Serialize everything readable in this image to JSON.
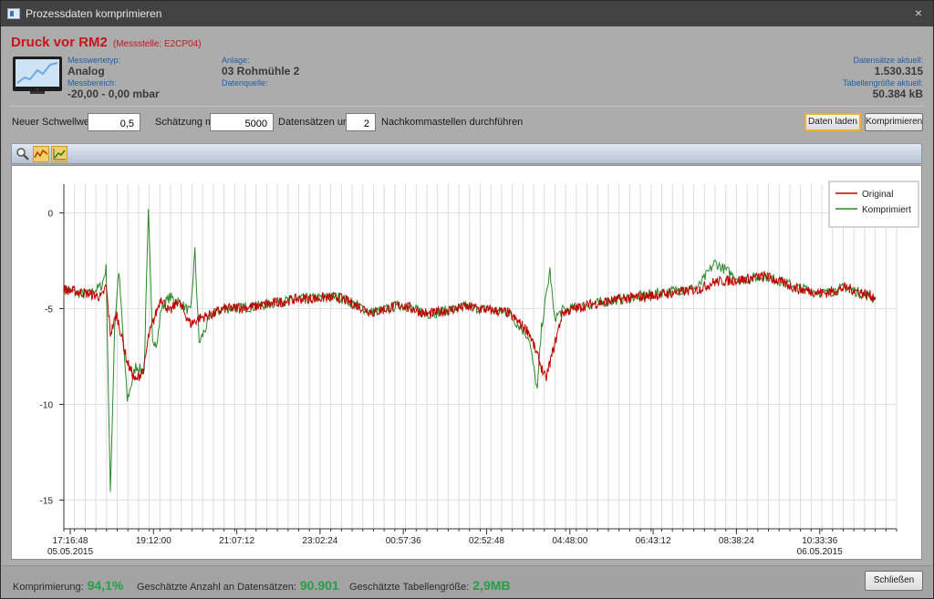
{
  "window": {
    "title": "Prozessdaten komprimieren",
    "close_glyph": "×"
  },
  "header": {
    "title": "Druck vor RM2",
    "subtitle": "(Messstelle: E2CP04)",
    "messwertetyp_label": "Messwertetyp:",
    "messwertetyp_value": "Analog",
    "messbereich_label": "Messbereich:",
    "messbereich_value": "-20,00 - 0,00 mbar",
    "anlage_label": "Anlage:",
    "anlage_value": "03 Rohmühle 2",
    "datenquelle_label": "Datenquelle:",
    "datenquelle_value": "",
    "datensaetze_label": "Datensätze aktuell:",
    "datensaetze_value": "1.530.315",
    "tabellengroesse_label": "Tabellengröße aktuell:",
    "tabellengroesse_value": "50.384 kB"
  },
  "controls": {
    "schwellwert_label": "Neuer Schwellwert:",
    "schwellwert_value": "0,5",
    "schaetzung_label": "Schätzung mit",
    "datensaetze_value": "5000",
    "datensaetze_und_label": "Datensätzen und",
    "nachkomma_value": "2",
    "nachkomma_label": "Nachkommastellen durchführen",
    "load_button": "Daten laden",
    "compress_button": "Komprimieren"
  },
  "toolbar": {
    "tools": [
      {
        "name": "zoom-icon",
        "active": false
      },
      {
        "name": "line-chart-icon",
        "active": true
      },
      {
        "name": "area-chart-icon",
        "active": true
      }
    ]
  },
  "chart_data": {
    "type": "line",
    "title": "",
    "xlabel": "",
    "ylabel": "",
    "ylim": [
      -16.5,
      1.5
    ],
    "yticks": [
      0,
      -5,
      -10,
      -15
    ],
    "ytick_labels": [
      "0",
      "-5",
      "-10",
      "-15"
    ],
    "xticks": [
      {
        "label": "17:16:48",
        "date": "05.05.2015"
      },
      {
        "label": "19:12:00",
        "date": ""
      },
      {
        "label": "21:07:12",
        "date": ""
      },
      {
        "label": "23:02:24",
        "date": ""
      },
      {
        "label": "00:57:36",
        "date": ""
      },
      {
        "label": "02:52:48",
        "date": ""
      },
      {
        "label": "04:48:00",
        "date": ""
      },
      {
        "label": "06:43:12",
        "date": ""
      },
      {
        "label": "08:38:24",
        "date": ""
      },
      {
        "label": "10:33:36",
        "date": "06.05.2015"
      }
    ],
    "legend_position": "top-right",
    "grid": true,
    "series": [
      {
        "name": "Original",
        "color": "#c00000",
        "x_hours": [
          0,
          0.55,
          0.9,
          1.0,
          1.1,
          1.25,
          1.5,
          1.7,
          1.9,
          2.0,
          2.3,
          2.5,
          2.7,
          3.0,
          3.2,
          3.5,
          3.8,
          4.5,
          5.5,
          6.5,
          7.3,
          8.0,
          8.6,
          9.5,
          10.5,
          11.0,
          11.4,
          11.8,
          12.4,
          13.2,
          14.0,
          15.0,
          15.4,
          16.0,
          16.6,
          17.4,
          18.0,
          18.5,
          19.2
        ],
        "values": [
          -4.0,
          -4.2,
          -4.4,
          -3.8,
          -6.3,
          -5.3,
          -7.8,
          -8.8,
          -8.1,
          -6.5,
          -4.4,
          -5.2,
          -4.6,
          -5.8,
          -5.5,
          -5.3,
          -5.0,
          -4.9,
          -4.5,
          -4.4,
          -5.2,
          -4.8,
          -5.3,
          -4.9,
          -5.2,
          -6.2,
          -8.7,
          -5.2,
          -4.8,
          -4.5,
          -4.3,
          -4.0,
          -3.6,
          -3.5,
          -3.3,
          -4.0,
          -4.2,
          -3.9,
          -4.4
        ]
      },
      {
        "name": "Komprimiert",
        "color": "#2a8a2a",
        "x_hours": [
          0,
          0.55,
          0.9,
          1.0,
          1.1,
          1.2,
          1.3,
          1.5,
          1.7,
          1.9,
          2.0,
          2.1,
          2.2,
          2.3,
          2.5,
          2.7,
          3.0,
          3.1,
          3.2,
          3.5,
          3.8,
          4.5,
          5.5,
          6.5,
          7.3,
          8.0,
          8.6,
          9.5,
          10.5,
          11.0,
          11.2,
          11.3,
          11.5,
          11.6,
          11.8,
          12.4,
          13.2,
          14.0,
          15.0,
          15.4,
          16.0,
          16.6,
          17.4,
          18.0,
          18.5,
          19.2
        ],
        "values": [
          -4.0,
          -4.3,
          -3.8,
          -2.9,
          -14.8,
          -6.0,
          -3.0,
          -9.8,
          -8.0,
          -8.3,
          0.0,
          -6.5,
          -7.0,
          -5.0,
          -4.4,
          -4.6,
          -5.2,
          -2.0,
          -6.8,
          -5.3,
          -5.0,
          -4.9,
          -4.5,
          -4.4,
          -5.2,
          -4.8,
          -5.3,
          -4.9,
          -5.2,
          -6.5,
          -9.3,
          -6.0,
          -3.0,
          -5.5,
          -5.1,
          -4.8,
          -4.5,
          -4.2,
          -3.9,
          -2.6,
          -3.5,
          -3.3,
          -3.9,
          -4.2,
          -3.9,
          -4.5
        ]
      }
    ]
  },
  "status": {
    "kompression_label": "Komprimierung:",
    "kompression_value": "94,1%",
    "anzahl_label": "Geschätzte Anzahl an Datensätzen:",
    "anzahl_value": "90.901",
    "groesse_label": "Geschätzte Tabellengröße:",
    "groesse_value": "2,9MB",
    "close_button": "Schließen"
  }
}
